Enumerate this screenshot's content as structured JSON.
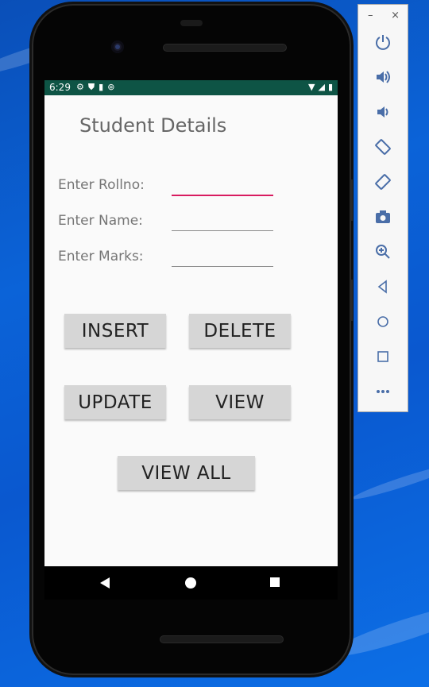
{
  "status_bar": {
    "time": "6:29",
    "icons": [
      "gear-icon",
      "shield-icon",
      "sd-card-icon",
      "sync-icon"
    ],
    "right_icons": [
      "wifi-icon",
      "signal-icon",
      "battery-icon"
    ]
  },
  "app": {
    "title": "Student Details",
    "fields": [
      {
        "label": "Enter Rollno:",
        "value": "",
        "focused": true
      },
      {
        "label": "Enter Name:",
        "value": "",
        "focused": false
      },
      {
        "label": "Enter Marks:",
        "value": "",
        "focused": false
      }
    ],
    "buttons": {
      "insert": "INSERT",
      "delete": "DELETE",
      "update": "UPDATE",
      "view": "VIEW",
      "view_all": "VIEW ALL"
    }
  },
  "toolbar": {
    "minimize": "–",
    "close": "×",
    "items": [
      "power-icon",
      "volume-up-icon",
      "volume-down-icon",
      "rotate-left-icon",
      "rotate-right-icon",
      "camera-icon",
      "zoom-icon",
      "back-icon",
      "home-icon",
      "overview-icon",
      "more-icon"
    ]
  },
  "colors": {
    "status_bar": "#0e5445",
    "accent": "#d81b60",
    "button_bg": "#d6d6d6",
    "toolbar_icon": "#4a6ea8"
  }
}
